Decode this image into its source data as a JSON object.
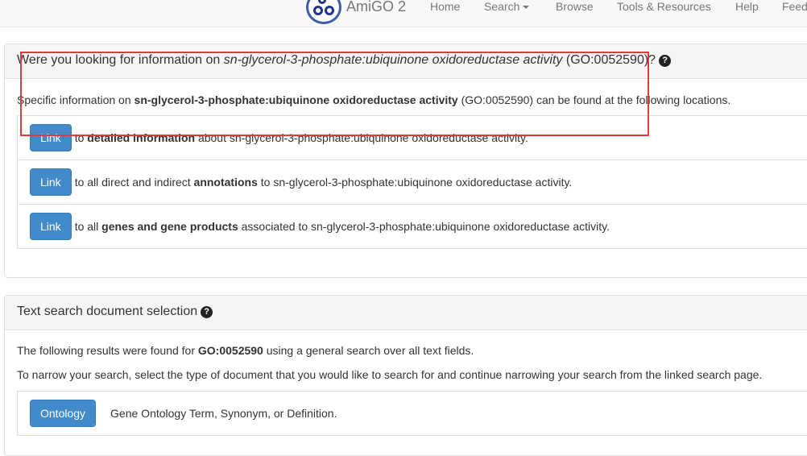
{
  "nav": {
    "brand": "AmiGO 2",
    "items": [
      "Home",
      "Search",
      "Browse",
      "Tools & Resources",
      "Help",
      "Feed"
    ]
  },
  "panel1": {
    "title_pre": "Were you looking for information on ",
    "title_term": "sn-glycerol-3-phosphate:ubiquinone oxidoreductase activity",
    "title_id": " (GO:0052590)",
    "title_post": "?",
    "intro_pre": "Specific information on ",
    "intro_term": "sn-glycerol-3-phosphate:ubiquinone oxidoreductase activity",
    "intro_post": " (GO:0052590) can be found at the following locations.",
    "links": [
      {
        "button": "Link",
        "pre": "to ",
        "bold": "detailed information",
        "post": " about sn-glycerol-3-phosphate:ubiquinone oxidoreductase activity."
      },
      {
        "button": "Link",
        "pre": "to all direct and indirect ",
        "bold": "annotations",
        "post": " to sn-glycerol-3-phosphate:ubiquinone oxidoreductase activity."
      },
      {
        "button": "Link",
        "pre": "to all ",
        "bold": "genes and gene products",
        "post": " associated to sn-glycerol-3-phosphate:ubiquinone oxidoreductase activity."
      }
    ]
  },
  "panel2": {
    "title": "Text search document selection",
    "line1_pre": "The following results were found for ",
    "line1_bold": "GO:0052590",
    "line1_post": " using a general search over all text fields.",
    "line2": "To narrow your search, select the type of document that you would like to search for and continue narrowing your search from the linked search page.",
    "items": [
      {
        "button": "Ontology",
        "desc": "Gene Ontology Term, Synonym, or Definition."
      }
    ]
  },
  "help_icon": "question-circle-icon",
  "colors": {
    "primary": "#428bca",
    "highlight": "#e23a3a"
  }
}
